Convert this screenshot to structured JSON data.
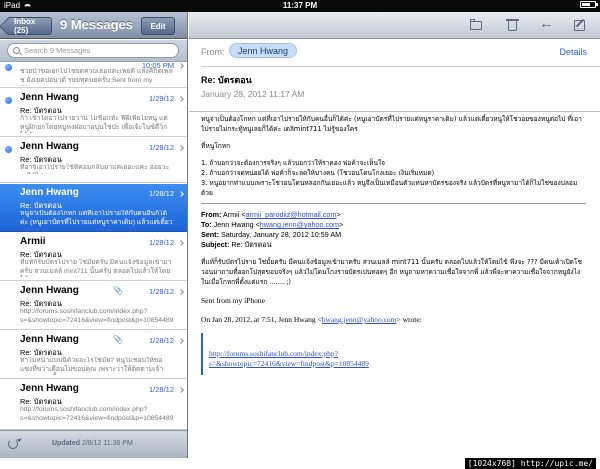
{
  "status": {
    "carrier": "iPad",
    "time": "11:37 PM",
    "battery_level": 0.7
  },
  "list": {
    "back_label": "Inbox (25)",
    "title": "9 Messages",
    "edit_label": "Edit",
    "search_placeholder": "Search 9 Messages",
    "messages": [
      {
        "sender": "",
        "date": "10:05 PM",
        "subject": "",
        "preview": "ช่วยบ้าขอเยกไปโซยดควบเธอแตะเพยดี แล่งคีกิตเพลช ยังเยคปอนาต์ รษยทุตนยครับ    Sent from my iPhone",
        "unread": true
      },
      {
        "sender": "Jenn Hwang",
        "date": "1/29/12",
        "subject": "Re: บัตรตอน",
        "preview": "ก้า เข้าไดอาไปรายวาน ไม่ชื่อเเท้ะ ฟีผีเพี่ยไยหนู แต่หนูฝิกยกโดยหนูหงฝอบาอบุ่นใช่ป่ะ เพื่อเจ้ะไนซ์ดีวิก ได้ชัน",
        "unread": true
      },
      {
        "sender": "Jenn Hwang",
        "date": "1/28/12",
        "subject": "Re: บัตรตอน",
        "preview": "ทื่อาจ้เอาไปรายใช้ที่ค่อมกลับมาแค่เยอะแค่ะ ออยวะ จะได้ไปเลย",
        "unread": true
      },
      {
        "sender": "Jenn Hwang",
        "date": "1/28/12",
        "subject": "Re: บัตรตอน",
        "preview": "หนูจ่าเป็นต้องโกหก แต่ที่เอาไปรายให้กับคนอื่นก็ได้ค่ะ (หนูเอาบัตรที่ไปรายแต่หนูราคาเดิม) แล้วแต่เดี๋ยวหนู",
        "unread": false
      },
      {
        "sender": "Armii",
        "date": "1/28/12",
        "subject": "Re: บัตรตอน",
        "preview": "ที่แท้ก็รับบัตรไปราย ใช่มั้ยครับ มีคนแจ้งข้อมูลเข้ามาครับ สวนเมลล์ mint711 นั้นครับ ตลอดไปแล้วให้โดยไข้",
        "unread": false
      },
      {
        "sender": "Jenn Hwang",
        "date": "1/28/12",
        "subject": "Re: บัตรตอน",
        "preview": "http://forums.soshifanclub.com/index.php?s=&showtopic=72416&view=findpost&p=10854489",
        "unread": false,
        "attachment": true
      },
      {
        "sender": "Jenn Hwang",
        "date": "1/28/12",
        "subject": "Re: บัตรตอน",
        "preview": "ทาไมหน้าแบบนี้ด้วยอะไรใช่มั้ย? หนูไม่ชอบให้ขอแซงที่ขวาเดือนไม่ขอบคุณ เพราะว่าให้ติดตามเจ้าเดอะบทอนนี้",
        "unread": false,
        "attachment": true
      },
      {
        "sender": "Jenn Hwang",
        "date": "1/28/12",
        "subject": "Re: บัตรตอน",
        "preview": "http://forums.soshifanclub.com/index.php?s=&showtopic=72416&view=findpost&p=10854489",
        "unread": false
      }
    ],
    "updated_label": "Updated",
    "updated_time": "2/8/12  11:36 PM"
  },
  "message": {
    "from_label": "From:",
    "from_name": "Jenn Hwang",
    "details_label": "Details",
    "subject": "Re: บัตรตอน",
    "date": "January 28, 2012 11:17 AM",
    "body_intro": "หนูจ่าเป็นต้องโกหก แต่ที่เอาไปรายให้กับคนอื่นก็ได้ค่ะ (หนูเอาบัตรที่ไปรายแต่หนูราคาเดิม) แล้วแต่เดี๋ยวหนูให้โชวอยของหนูต่อไป ที่เอาไปรายไม่กระทู้หนูเลยก็ได้ค่ะ เดลิmint711 ไม่รู้ของใคร",
    "body_point_title": "ที่หนูโกหก",
    "body_point1": "1. ถ้าบอกว่าจะต้องการจริงๆ แล้วบอกว่าให้ราคอง พ่อค้าจะเห็นใจ",
    "body_point2": "2. ถ้าบอกว่าจดหน่อยได้ พ่อค้าก็จะลดให้บางคน (โชวอนโดนโกงเยอะ เงินเริ่มหมด)",
    "body_point3": "3. หนูอยากท่าแบบเพราะโชวอนโดนหลอกกันเยอะแล้ว หนูจึงเป็นเหมือนตัวแทนหาบัตรของจริง แล้วบัตรที่หนูหามาได้ก็ไม่ใช่ของปลอมด้วย",
    "fwd_from_label": "From:",
    "fwd_from_value": "Armii <",
    "fwd_from_email": "armii_parodiiz@hotmail.com",
    "fwd_from_end": ">",
    "fwd_to_label": "To:",
    "fwd_to_value": "Jenn Hwang <",
    "fwd_to_email": "hwang.jenn@yahoo.com",
    "fwd_to_end": ">",
    "fwd_sent_label": "Sent:",
    "fwd_sent_value": "Saturday, January 28, 2012 10:59 AM",
    "fwd_subject_label": "Subject:",
    "fwd_subject_value": "Re: บัตรตอน",
    "fwd_body": "ที่แท้ก็รับบัตรไปราย ใช่มั้ยครับ มีคนแจ้งข้อมูลเข้ามาครับ สวนเมลล์ mint711 นั้นครับ ตลอดไปแล้วให้โดยไข้ พึงจะ ??? มีคนเค้าเปิดโชวอนมาถามที่ออกโปสุดขอบจริงๆ แล้วไม่โดนโกงรายบัตรเปนทอดๆ อีก หนูถามหาความเชื่อใจจากพี่ แล้วพี่จะหาความเชื่อใจจากหนูยังไง ในเมื่อโกหกพี่ตั้งแต่แรก ....... ;)",
    "sent_from": "Sent from my iPhone",
    "wrote_prefix": "On Jan 28, 2012, at 7:51, Jenn Hwang <",
    "wrote_email": "hwang.jenn@yahoo.com",
    "wrote_suffix": "> wrote:",
    "quote_link1": "http://forums.soshifanclub.com/index.php?",
    "quote_link2": "s=&showtopic=72416&view=findpost&p=10854489"
  },
  "watermark": "[1024x768] http://upic.me/"
}
